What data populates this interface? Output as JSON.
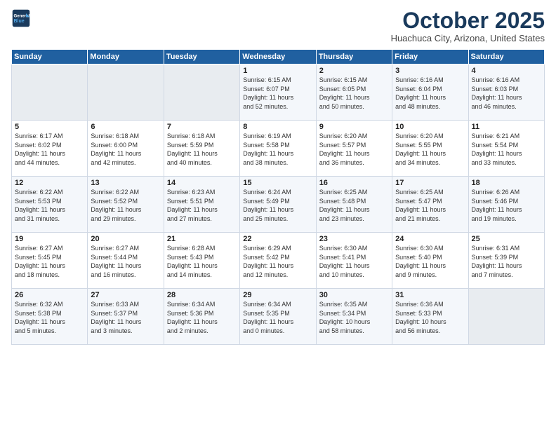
{
  "logo": {
    "line1": "General",
    "line2": "Blue"
  },
  "title": "October 2025",
  "subtitle": "Huachuca City, Arizona, United States",
  "days_header": [
    "Sunday",
    "Monday",
    "Tuesday",
    "Wednesday",
    "Thursday",
    "Friday",
    "Saturday"
  ],
  "weeks": [
    [
      {
        "day": "",
        "text": ""
      },
      {
        "day": "",
        "text": ""
      },
      {
        "day": "",
        "text": ""
      },
      {
        "day": "1",
        "text": "Sunrise: 6:15 AM\nSunset: 6:07 PM\nDaylight: 11 hours\nand 52 minutes."
      },
      {
        "day": "2",
        "text": "Sunrise: 6:15 AM\nSunset: 6:05 PM\nDaylight: 11 hours\nand 50 minutes."
      },
      {
        "day": "3",
        "text": "Sunrise: 6:16 AM\nSunset: 6:04 PM\nDaylight: 11 hours\nand 48 minutes."
      },
      {
        "day": "4",
        "text": "Sunrise: 6:16 AM\nSunset: 6:03 PM\nDaylight: 11 hours\nand 46 minutes."
      }
    ],
    [
      {
        "day": "5",
        "text": "Sunrise: 6:17 AM\nSunset: 6:02 PM\nDaylight: 11 hours\nand 44 minutes."
      },
      {
        "day": "6",
        "text": "Sunrise: 6:18 AM\nSunset: 6:00 PM\nDaylight: 11 hours\nand 42 minutes."
      },
      {
        "day": "7",
        "text": "Sunrise: 6:18 AM\nSunset: 5:59 PM\nDaylight: 11 hours\nand 40 minutes."
      },
      {
        "day": "8",
        "text": "Sunrise: 6:19 AM\nSunset: 5:58 PM\nDaylight: 11 hours\nand 38 minutes."
      },
      {
        "day": "9",
        "text": "Sunrise: 6:20 AM\nSunset: 5:57 PM\nDaylight: 11 hours\nand 36 minutes."
      },
      {
        "day": "10",
        "text": "Sunrise: 6:20 AM\nSunset: 5:55 PM\nDaylight: 11 hours\nand 34 minutes."
      },
      {
        "day": "11",
        "text": "Sunrise: 6:21 AM\nSunset: 5:54 PM\nDaylight: 11 hours\nand 33 minutes."
      }
    ],
    [
      {
        "day": "12",
        "text": "Sunrise: 6:22 AM\nSunset: 5:53 PM\nDaylight: 11 hours\nand 31 minutes."
      },
      {
        "day": "13",
        "text": "Sunrise: 6:22 AM\nSunset: 5:52 PM\nDaylight: 11 hours\nand 29 minutes."
      },
      {
        "day": "14",
        "text": "Sunrise: 6:23 AM\nSunset: 5:51 PM\nDaylight: 11 hours\nand 27 minutes."
      },
      {
        "day": "15",
        "text": "Sunrise: 6:24 AM\nSunset: 5:49 PM\nDaylight: 11 hours\nand 25 minutes."
      },
      {
        "day": "16",
        "text": "Sunrise: 6:25 AM\nSunset: 5:48 PM\nDaylight: 11 hours\nand 23 minutes."
      },
      {
        "day": "17",
        "text": "Sunrise: 6:25 AM\nSunset: 5:47 PM\nDaylight: 11 hours\nand 21 minutes."
      },
      {
        "day": "18",
        "text": "Sunrise: 6:26 AM\nSunset: 5:46 PM\nDaylight: 11 hours\nand 19 minutes."
      }
    ],
    [
      {
        "day": "19",
        "text": "Sunrise: 6:27 AM\nSunset: 5:45 PM\nDaylight: 11 hours\nand 18 minutes."
      },
      {
        "day": "20",
        "text": "Sunrise: 6:27 AM\nSunset: 5:44 PM\nDaylight: 11 hours\nand 16 minutes."
      },
      {
        "day": "21",
        "text": "Sunrise: 6:28 AM\nSunset: 5:43 PM\nDaylight: 11 hours\nand 14 minutes."
      },
      {
        "day": "22",
        "text": "Sunrise: 6:29 AM\nSunset: 5:42 PM\nDaylight: 11 hours\nand 12 minutes."
      },
      {
        "day": "23",
        "text": "Sunrise: 6:30 AM\nSunset: 5:41 PM\nDaylight: 11 hours\nand 10 minutes."
      },
      {
        "day": "24",
        "text": "Sunrise: 6:30 AM\nSunset: 5:40 PM\nDaylight: 11 hours\nand 9 minutes."
      },
      {
        "day": "25",
        "text": "Sunrise: 6:31 AM\nSunset: 5:39 PM\nDaylight: 11 hours\nand 7 minutes."
      }
    ],
    [
      {
        "day": "26",
        "text": "Sunrise: 6:32 AM\nSunset: 5:38 PM\nDaylight: 11 hours\nand 5 minutes."
      },
      {
        "day": "27",
        "text": "Sunrise: 6:33 AM\nSunset: 5:37 PM\nDaylight: 11 hours\nand 3 minutes."
      },
      {
        "day": "28",
        "text": "Sunrise: 6:34 AM\nSunset: 5:36 PM\nDaylight: 11 hours\nand 2 minutes."
      },
      {
        "day": "29",
        "text": "Sunrise: 6:34 AM\nSunset: 5:35 PM\nDaylight: 11 hours\nand 0 minutes."
      },
      {
        "day": "30",
        "text": "Sunrise: 6:35 AM\nSunset: 5:34 PM\nDaylight: 10 hours\nand 58 minutes."
      },
      {
        "day": "31",
        "text": "Sunrise: 6:36 AM\nSunset: 5:33 PM\nDaylight: 10 hours\nand 56 minutes."
      },
      {
        "day": "",
        "text": ""
      }
    ]
  ]
}
